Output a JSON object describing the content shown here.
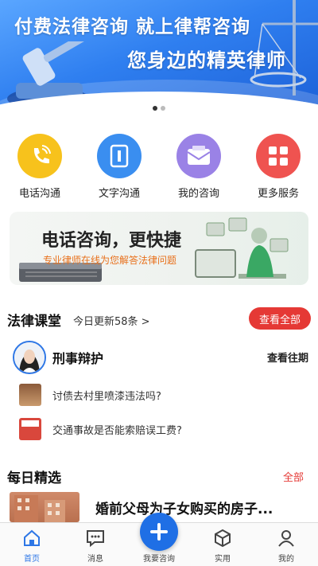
{
  "banner": {
    "headline": "付费法律咨询 就上律帮咨询",
    "subline": "您身边的精英律师",
    "slides": 2,
    "active_slide": 1
  },
  "quick_services": [
    {
      "label": "电话沟通",
      "icon": "phone-icon",
      "color": "#f7c21c"
    },
    {
      "label": "文字沟通",
      "icon": "text-chat-icon",
      "color": "#3a8ef0"
    },
    {
      "label": "我的咨询",
      "icon": "mail-icon",
      "color": "#9a82e6"
    },
    {
      "label": "更多服务",
      "icon": "grid-icon",
      "color": "#ef5350"
    }
  ],
  "promo": {
    "title": "电话咨询，更快捷",
    "subtitle": "专业律师在线为您解答法律问题"
  },
  "law_class": {
    "title": "法律课堂",
    "update": "今日更新58条 >",
    "view_all": "查看全部",
    "column_name": "刑事辩护",
    "past_issues": "查看往期",
    "articles": [
      {
        "title": "讨债去村里喷漆违法吗?"
      },
      {
        "title": "交通事故是否能索赔误工费?"
      }
    ]
  },
  "daily_picks": {
    "title": "每日精选",
    "all": "全部",
    "first_item": "婚前父母为子女购买的房子..."
  },
  "bottom_nav": {
    "tabs": [
      {
        "label": "首页",
        "icon": "home-icon",
        "active": true
      },
      {
        "label": "消息",
        "icon": "message-icon",
        "active": false
      },
      {
        "label": "我要咨询",
        "icon": "plus-icon",
        "active": false
      },
      {
        "label": "实用",
        "icon": "cube-icon",
        "active": false
      },
      {
        "label": "我的",
        "icon": "user-icon",
        "active": false
      }
    ]
  },
  "colors": {
    "brand_blue": "#2e77e6",
    "accent_red": "#e53935",
    "promo_orange": "#e8701b"
  }
}
